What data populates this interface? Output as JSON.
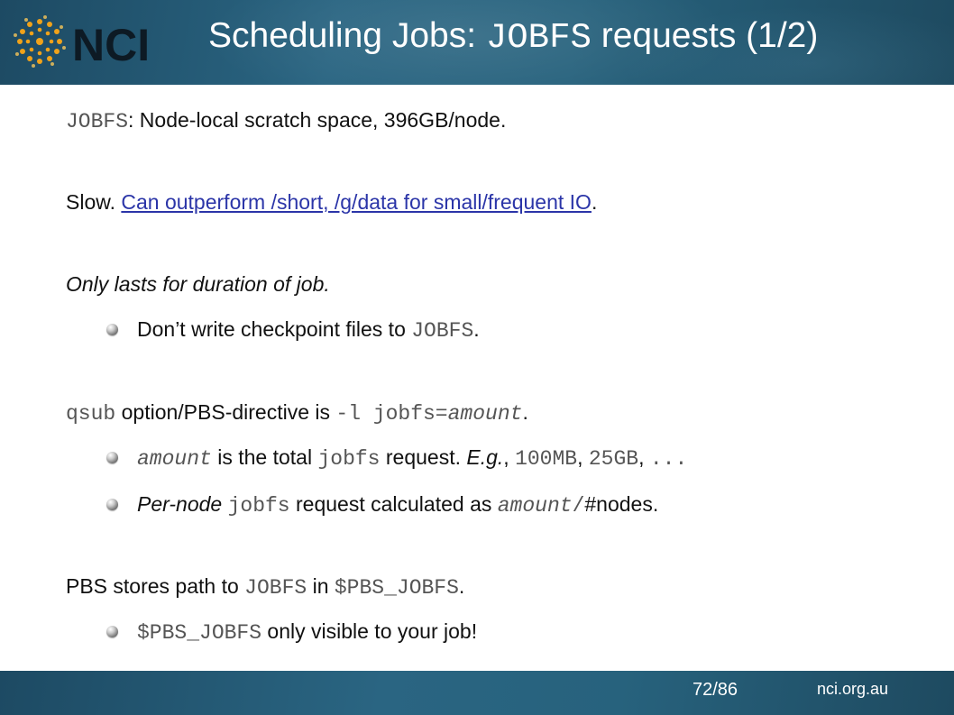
{
  "header": {
    "logo_text": "NCI",
    "title_prefix": "Scheduling Jobs: ",
    "title_code": "JOBFS",
    "title_suffix": " requests (1/2)"
  },
  "lines": {
    "l1": {
      "code": "JOBFS",
      "text": ": Node-local scratch space, 396GB/node."
    },
    "l2": {
      "text": "Slow. ",
      "link": "Can outperform /short, /g/data for small/frequent IO",
      "tail": "."
    },
    "l3": {
      "text": "Only lasts for duration of job."
    },
    "l4": {
      "text": "Don’t write checkpoint files to ",
      "code": "JOBFS",
      "tail": "."
    },
    "l5": {
      "code1": "qsub",
      "text": " option/PBS-directive is ",
      "code2": "-l jobfs=",
      "code3": "amount",
      "tail": "."
    },
    "l6": {
      "code1": "amount",
      "text1": " is the ",
      "bold": "total",
      "text2": " ",
      "code2": "jobfs",
      "text3": " request. ",
      "ital": "E.g.",
      "text4": ", ",
      "code3": "100MB",
      "text5": ", ",
      "code4": "25GB",
      "text6": ", ",
      "code5": "..."
    },
    "l7": {
      "ital": "Per-node",
      "text1": " ",
      "code1": "jobfs",
      "text2": " request calculated as ",
      "code2": "amount",
      "code3": "/",
      "text3": "#nodes."
    },
    "l8": {
      "text1": "PBS stores path to ",
      "code1": "JOBFS",
      "text2": " in ",
      "code2": "$PBS_JOBFS",
      "tail": "."
    },
    "l9": {
      "code": "$PBS_JOBFS",
      "text": " only visible to your job!"
    }
  },
  "footer": {
    "page": "72/86",
    "site": "nci.org.au"
  },
  "colors": {
    "header_bg": "#2a6582",
    "link": "#2b35a8",
    "logo_orange": "#f0a21a"
  }
}
